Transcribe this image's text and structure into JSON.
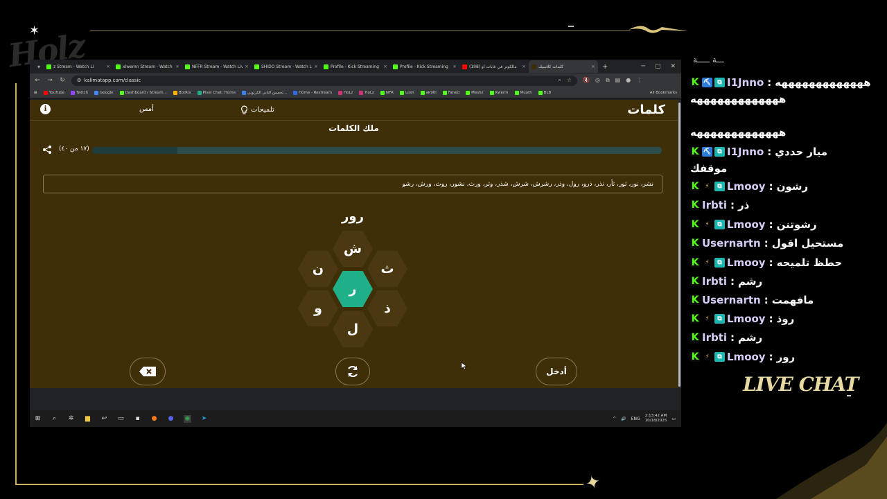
{
  "overlay": {
    "logo_text": "Holz",
    "live_chat_label": "LIVE CHAT"
  },
  "browser": {
    "tabs": [
      {
        "label": "z Stream - Watch Li",
        "color": "#53fc18"
      },
      {
        "label": "xlwemn Stream - Watch Li",
        "color": "#53fc18"
      },
      {
        "label": "NFFR Stream - Watch Live",
        "color": "#53fc18"
      },
      {
        "label": "SHIDO Stream - Watch Li",
        "color": "#53fc18"
      },
      {
        "label": "Profile - Kick Streaming",
        "color": "#53fc18"
      },
      {
        "label": "Profile - Kick Streaming",
        "color": "#53fc18"
      },
      {
        "label": "(198) مالكوتر في غابات أو",
        "color": "#ff0000"
      },
      {
        "label": "كلمات كلاسيك",
        "color": "#3f2f08"
      }
    ],
    "url": "kalimatapp.com/classic",
    "bookmarks": [
      "YouTube",
      "Twitch",
      "Google",
      "Dashboard / Stream...",
      "BotRix",
      "Pixel Chat: Home",
      "تحسين التابي الكرتوني...",
      "Home - Restream",
      "HoLz",
      "HoLz",
      "NFR",
      "Losh",
      "ak90l",
      "Fahed",
      "Meshz",
      "Kwerm",
      "Muath",
      "BL8"
    ],
    "all_bookmarks": "All Bookmarks"
  },
  "app": {
    "brand": "كلمات",
    "hints_label": "تلميحات",
    "yesterday_label": "أمس",
    "rank_title": "ملك الكلمات",
    "progress_text": "(١٧ من ٤٠)",
    "progress_fraction": 0.85,
    "found_words": "نشر، نور، ثور، ثأر، نذر، ذرو، رول، وذر، رشرش، شرش، شذر، وثر، ورث، نشور، روث، ورش، رشو",
    "current_word": "رور",
    "center_letter": "ر",
    "letters": {
      "top": "ش",
      "top_right": "ث",
      "bottom_right": "ذ",
      "bottom": "ل",
      "bottom_left": "و",
      "top_left": "ن"
    },
    "enter_label": "أدخل",
    "colors": {
      "page_bg": "#3f2f08",
      "center_hex": "#1fb08a",
      "outer_hex": "#4a3810"
    }
  },
  "taskbar": {
    "lang": "ENG",
    "time": "2:13:42 AM",
    "date": "10/18/2025"
  },
  "chat": {
    "top_clipped": "ـــة ـــــة",
    "messages": [
      {
        "user": "I1Jnno",
        "text": "هههههههههههههه",
        "badges": [
          "b1",
          "b2"
        ]
      },
      {
        "user": "I1Jnno",
        "text": "ميار حددي",
        "badges": [
          "b1",
          "b2"
        ]
      },
      {
        "user": "Lmooy",
        "text": "رشون",
        "badges": [
          "b3",
          "b2"
        ]
      },
      {
        "user": "Irbti",
        "text": "ذر",
        "badges": []
      },
      {
        "user": "Lmooy",
        "text": "رشوتنن",
        "badges": [
          "b3",
          "b2"
        ]
      },
      {
        "user": "Usernartn",
        "text": "مستحيل اقول",
        "badges": []
      },
      {
        "user": "Lmooy",
        "text": "حطظ تلميحه",
        "badges": [
          "b3",
          "b2"
        ]
      },
      {
        "user": "Irbti",
        "text": "رشم",
        "badges": []
      },
      {
        "user": "Usernartn",
        "text": "مافهمت",
        "badges": []
      },
      {
        "user": "Lmooy",
        "text": "روذ",
        "badges": [
          "b3",
          "b2"
        ]
      },
      {
        "user": "Irbti",
        "text": "رشم",
        "badges": []
      },
      {
        "user": "Lmooy",
        "text": "رور",
        "badges": [
          "b3",
          "b2"
        ]
      }
    ],
    "continuations": {
      "first_line2": "هههههههههههههه",
      "first_line3": "هههههههههههههه",
      "second_line2": "موقفك"
    }
  }
}
